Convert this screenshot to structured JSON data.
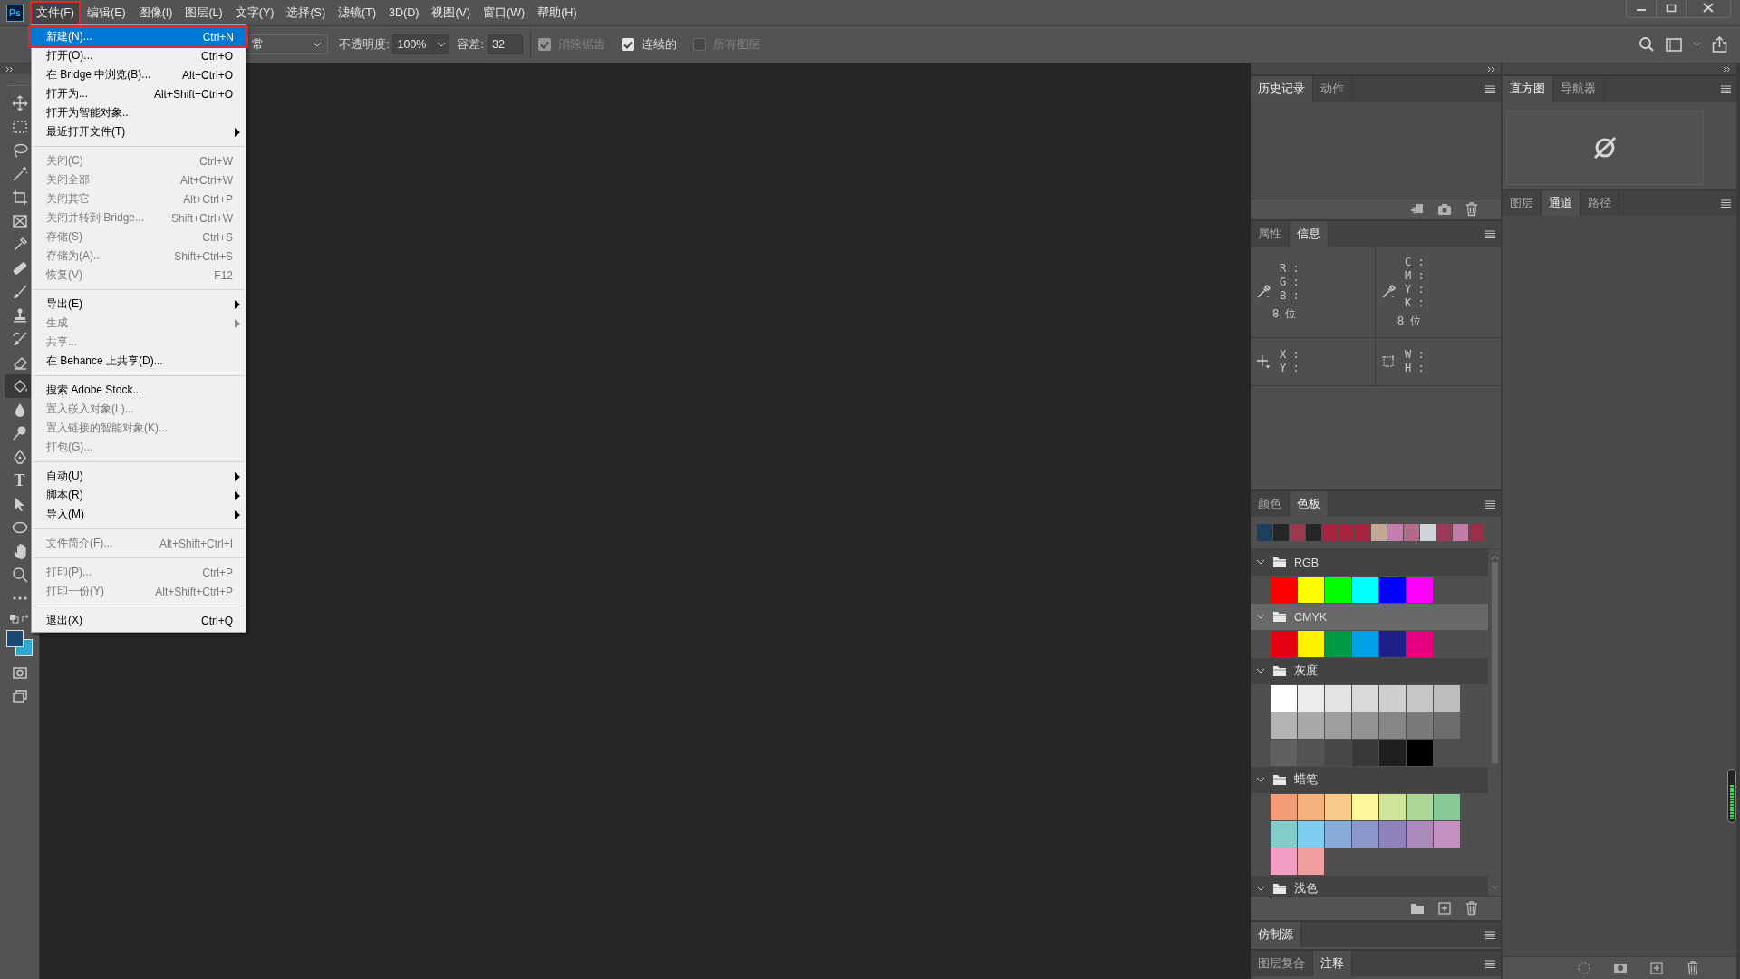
{
  "app_logo": "Ps",
  "menu_bar": [
    {
      "label": "文件(F)",
      "selected": true
    },
    {
      "label": "编辑(E)",
      "selected": false
    },
    {
      "label": "图像(I)",
      "selected": false
    },
    {
      "label": "图层(L)",
      "selected": false
    },
    {
      "label": "文字(Y)",
      "selected": false
    },
    {
      "label": "选择(S)",
      "selected": false
    },
    {
      "label": "滤镜(T)",
      "selected": false
    },
    {
      "label": "3D(D)",
      "selected": false
    },
    {
      "label": "视图(V)",
      "selected": false
    },
    {
      "label": "窗口(W)",
      "selected": false
    },
    {
      "label": "帮助(H)",
      "selected": false
    }
  ],
  "options_bar": {
    "blend_mode": "常",
    "opacity_label": "不透明度:",
    "opacity": "100%",
    "tolerance_label": "容差:",
    "tolerance": "32",
    "checkboxes": [
      {
        "label": "消除锯齿",
        "checked": true,
        "disabled": true
      },
      {
        "label": "连续的",
        "checked": true,
        "disabled": false
      },
      {
        "label": "所有图层",
        "checked": false,
        "disabled": true
      }
    ]
  },
  "toolbar": {
    "type_tool": "T"
  },
  "file_menu": [
    {
      "kind": "item",
      "label": "新建(N)...",
      "shortcut": "Ctrl+N",
      "selected": true,
      "disabled": false,
      "submenu": false
    },
    {
      "kind": "item",
      "label": "打开(O)...",
      "shortcut": "Ctrl+O",
      "selected": false,
      "disabled": false,
      "submenu": false
    },
    {
      "kind": "item",
      "label": "在 Bridge 中浏览(B)...",
      "shortcut": "Alt+Ctrl+O",
      "selected": false,
      "disabled": false,
      "submenu": false
    },
    {
      "kind": "item",
      "label": "打开为...",
      "shortcut": "Alt+Shift+Ctrl+O",
      "selected": false,
      "disabled": false,
      "submenu": false
    },
    {
      "kind": "item",
      "label": "打开为智能对象...",
      "selected": false,
      "disabled": false,
      "submenu": false
    },
    {
      "kind": "item",
      "label": "最近打开文件(T)",
      "selected": false,
      "disabled": false,
      "submenu": true
    },
    {
      "kind": "separator"
    },
    {
      "kind": "item",
      "label": "关闭(C)",
      "shortcut": "Ctrl+W",
      "selected": false,
      "disabled": true,
      "submenu": false
    },
    {
      "kind": "item",
      "label": "关闭全部",
      "shortcut": "Alt+Ctrl+W",
      "selected": false,
      "disabled": true,
      "submenu": false
    },
    {
      "kind": "item",
      "label": "关闭其它",
      "shortcut": "Alt+Ctrl+P",
      "selected": false,
      "disabled": true,
      "submenu": false
    },
    {
      "kind": "item",
      "label": "关闭并转到 Bridge...",
      "shortcut": "Shift+Ctrl+W",
      "selected": false,
      "disabled": true,
      "submenu": false
    },
    {
      "kind": "item",
      "label": "存储(S)",
      "shortcut": "Ctrl+S",
      "selected": false,
      "disabled": true,
      "submenu": false
    },
    {
      "kind": "item",
      "label": "存储为(A)...",
      "shortcut": "Shift+Ctrl+S",
      "selected": false,
      "disabled": true,
      "submenu": false
    },
    {
      "kind": "item",
      "label": "恢复(V)",
      "shortcut": "F12",
      "selected": false,
      "disabled": true,
      "submenu": false
    },
    {
      "kind": "separator"
    },
    {
      "kind": "item",
      "label": "导出(E)",
      "selected": false,
      "disabled": false,
      "submenu": true
    },
    {
      "kind": "item",
      "label": "生成",
      "selected": false,
      "disabled": true,
      "submenu": true
    },
    {
      "kind": "item",
      "label": "共享...",
      "selected": false,
      "disabled": true,
      "submenu": false
    },
    {
      "kind": "item",
      "label": "在 Behance 上共享(D)...",
      "selected": false,
      "disabled": false,
      "submenu": false
    },
    {
      "kind": "separator"
    },
    {
      "kind": "item",
      "label": "搜索 Adobe Stock...",
      "selected": false,
      "disabled": false,
      "submenu": false
    },
    {
      "kind": "item",
      "label": "置入嵌入对象(L)...",
      "selected": false,
      "disabled": true,
      "submenu": false
    },
    {
      "kind": "item",
      "label": "置入链接的智能对象(K)...",
      "selected": false,
      "disabled": true,
      "submenu": false
    },
    {
      "kind": "item",
      "label": "打包(G)...",
      "selected": false,
      "disabled": true,
      "submenu": false
    },
    {
      "kind": "separator"
    },
    {
      "kind": "item",
      "label": "自动(U)",
      "selected": false,
      "disabled": false,
      "submenu": true
    },
    {
      "kind": "item",
      "label": "脚本(R)",
      "selected": false,
      "disabled": false,
      "submenu": true
    },
    {
      "kind": "item",
      "label": "导入(M)",
      "selected": false,
      "disabled": false,
      "submenu": true
    },
    {
      "kind": "separator"
    },
    {
      "kind": "item",
      "label": "文件简介(F)...",
      "shortcut": "Alt+Shift+Ctrl+I",
      "selected": false,
      "disabled": true,
      "submenu": false
    },
    {
      "kind": "separator"
    },
    {
      "kind": "item",
      "label": "打印(P)...",
      "shortcut": "Ctrl+P",
      "selected": false,
      "disabled": true,
      "submenu": false
    },
    {
      "kind": "item",
      "label": "打印一份(Y)",
      "shortcut": "Alt+Shift+Ctrl+P",
      "selected": false,
      "disabled": true,
      "submenu": false
    },
    {
      "kind": "separator"
    },
    {
      "kind": "item",
      "label": "退出(X)",
      "shortcut": "Ctrl+Q",
      "selected": false,
      "disabled": false,
      "submenu": false
    }
  ],
  "history_panel": {
    "tabs": [
      {
        "label": "历史记录",
        "selected": true
      },
      {
        "label": "动作",
        "selected": false
      }
    ]
  },
  "info_panel": {
    "tabs": [
      {
        "label": "属性",
        "selected": false
      },
      {
        "label": "信息",
        "selected": true
      }
    ],
    "readouts": [
      {
        "channels": [
          "R :",
          "G :",
          "B :"
        ],
        "bit_depth": "8 位"
      },
      {
        "channels": [
          "C :",
          "M :",
          "Y :",
          "K :"
        ],
        "bit_depth": "8 位"
      }
    ],
    "position": [
      "X :",
      "Y :"
    ],
    "size": [
      "W :",
      "H :"
    ]
  },
  "swatches_panel": {
    "tabs": [
      {
        "label": "颜色",
        "selected": false
      },
      {
        "label": "色板",
        "selected": true
      }
    ],
    "recent": [
      {
        "color": "#1c3f5e"
      },
      {
        "color": "#262626"
      },
      {
        "color": "#9a3a4e"
      },
      {
        "color": "#262626"
      },
      {
        "color": "#a8233f"
      },
      {
        "color": "#a8233f"
      },
      {
        "color": "#a8233f"
      },
      {
        "color": "#c4a896"
      },
      {
        "color": "#c87bb0"
      },
      {
        "color": "#b5688a"
      },
      {
        "color": "#d0d4dc"
      },
      {
        "color": "#9c3a5a"
      },
      {
        "color": "#c47aa8"
      },
      {
        "color": "#9a3048"
      }
    ],
    "groups": [
      {
        "name": "RGB",
        "expanded": true,
        "selected": false,
        "swatches": [
          {
            "color": "#ff0000"
          },
          {
            "color": "#ffff00"
          },
          {
            "color": "#00ff00"
          },
          {
            "color": "#00ffff"
          },
          {
            "color": "#0000ff"
          },
          {
            "color": "#ff00ff"
          }
        ]
      },
      {
        "name": "CMYK",
        "expanded": true,
        "selected": true,
        "swatches": [
          {
            "color": "#e60012"
          },
          {
            "color": "#fff100"
          },
          {
            "color": "#009944"
          },
          {
            "color": "#00a0e9"
          },
          {
            "color": "#1d2088"
          },
          {
            "color": "#e4007f"
          }
        ]
      },
      {
        "name": "灰度",
        "expanded": true,
        "selected": false,
        "swatches": [
          {
            "color": "#ffffff"
          },
          {
            "color": "#ececec"
          },
          {
            "color": "#e3e3e3"
          },
          {
            "color": "#d9d9d9"
          },
          {
            "color": "#cfcfcf"
          },
          {
            "color": "#c6c6c6"
          },
          {
            "color": "#bdbdbd"
          },
          {
            "color": "#b3b3b3"
          },
          {
            "color": "#a8a8a8"
          },
          {
            "color": "#9e9e9e"
          },
          {
            "color": "#939393"
          },
          {
            "color": "#868686"
          },
          {
            "color": "#7a7a7a"
          },
          {
            "color": "#6d6d6d"
          },
          {
            "color": "#606060"
          },
          {
            "color": "#545454"
          },
          {
            "color": "#474747"
          },
          {
            "color": "#393939"
          },
          {
            "color": "#1f1f1f"
          },
          {
            "color": "#000000"
          }
        ]
      },
      {
        "name": "蜡笔",
        "expanded": true,
        "selected": false,
        "swatches": [
          {
            "color": "#f29c78"
          },
          {
            "color": "#f5b17e"
          },
          {
            "color": "#f9cb8b"
          },
          {
            "color": "#fff799"
          },
          {
            "color": "#d1e49c"
          },
          {
            "color": "#acd598"
          },
          {
            "color": "#89c997"
          },
          {
            "color": "#84ccc9"
          },
          {
            "color": "#7ecef4"
          },
          {
            "color": "#88abda"
          },
          {
            "color": "#8c97cb"
          },
          {
            "color": "#8f82bc"
          },
          {
            "color": "#aa89bd"
          },
          {
            "color": "#c490bf"
          },
          {
            "color": "#f19ec2"
          },
          {
            "color": "#f19e9e"
          }
        ]
      },
      {
        "name": "浅色",
        "expanded": true,
        "selected": false
      }
    ]
  },
  "clone_source_panel": {
    "tabs": [
      {
        "label": "仿制源",
        "selected": true
      }
    ]
  },
  "notes_panel": {
    "tabs": [
      {
        "label": "图层复合",
        "selected": false
      },
      {
        "label": "注释",
        "selected": true
      }
    ]
  },
  "histogram_panel": {
    "tabs": [
      {
        "label": "直方图",
        "selected": true
      },
      {
        "label": "导航器",
        "selected": false
      }
    ]
  },
  "channels_panel": {
    "tabs": [
      {
        "label": "图层",
        "selected": false
      },
      {
        "label": "通道",
        "selected": true
      },
      {
        "label": "路径",
        "selected": false
      }
    ]
  }
}
